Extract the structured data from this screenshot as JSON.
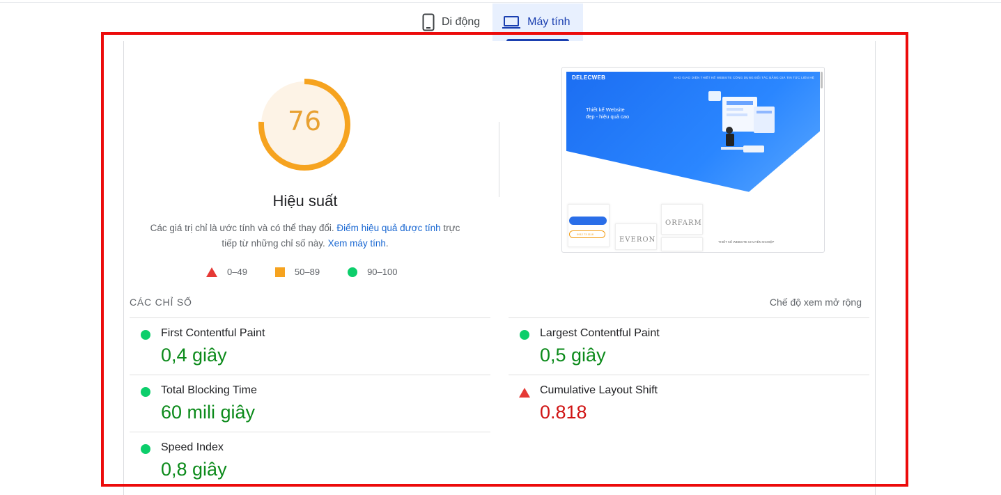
{
  "tabs": [
    {
      "label": "Di động",
      "icon": "mobile-phone-icon",
      "active": false
    },
    {
      "label": "Máy tính",
      "icon": "laptop-icon",
      "active": true
    }
  ],
  "performance": {
    "score": "76",
    "score_fraction": 0.76,
    "title": "Hiệu suất",
    "desc_prefix": "Các giá trị chỉ là ước tính và có thể thay đổi. ",
    "desc_link1": "Điểm hiệu quả được tính",
    "desc_mid": " trực tiếp từ những chỉ số này. ",
    "desc_link2": "Xem máy tính",
    "desc_suffix": ".",
    "colors": {
      "average": "#f6a31f",
      "average_bg": "#fdf3e6",
      "link": "#1967d2"
    }
  },
  "legend": [
    {
      "range": "0–49",
      "shape": "triangle",
      "color": "#e53935"
    },
    {
      "range": "50–89",
      "shape": "square",
      "color": "#f6a31f"
    },
    {
      "range": "90–100",
      "shape": "circle",
      "color": "#0cce6b"
    }
  ],
  "screenshot": {
    "logo": "DELECWEB",
    "nav": "KHO GIAO DIỆN   THIẾT KẾ WEBSITE   CÔNG DỤNG   ĐỐI TÁC   BẢNG GIÁ   TIN TỨC   LIÊN HỆ",
    "headline_1": "Thiết kế Website",
    "headline_2": "đẹp - hiệu quả cao",
    "brand_1": "EVERON",
    "brand_2": "ORFARM",
    "phone": "0912 73 1118",
    "footer_text": "THIẾT KẾ WEBSITE CHUYÊN NGHIỆP"
  },
  "metrics_section": {
    "header": "CÁC CHỈ SỐ",
    "expand_label": "Chế độ xem mở rộng"
  },
  "metrics": [
    {
      "title": "First Contentful Paint",
      "value": "0,4 giây",
      "status": "good"
    },
    {
      "title": "Largest Contentful Paint",
      "value": "0,5 giây",
      "status": "good"
    },
    {
      "title": "Total Blocking Time",
      "value": "60 mili giây",
      "status": "good"
    },
    {
      "title": "Cumulative Layout Shift",
      "value": "0.818",
      "status": "bad"
    },
    {
      "title": "Speed Index",
      "value": "0,8 giây",
      "status": "good"
    }
  ],
  "status_colors": {
    "good_text": "#0b8a1a",
    "bad_text": "#d01414",
    "highlight": "#ec0b0b"
  }
}
